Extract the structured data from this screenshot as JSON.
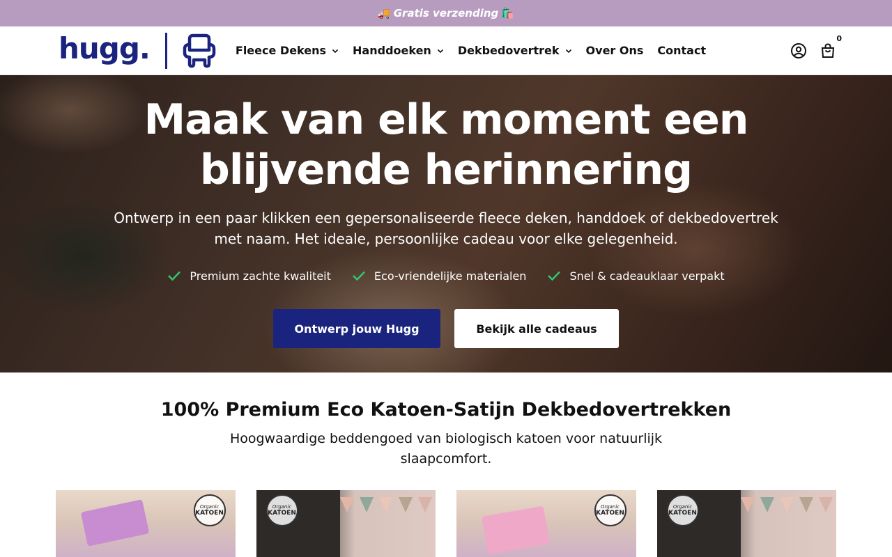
{
  "announcement": {
    "icon_left": "🚚",
    "text": "Gratis verzending",
    "icon_right": "🛍️"
  },
  "header": {
    "logo_text": "hugg.",
    "nav": [
      {
        "label": "Fleece Dekens",
        "has_dropdown": true
      },
      {
        "label": "Handdoeken",
        "has_dropdown": true
      },
      {
        "label": "Dekbedovertrek",
        "has_dropdown": true
      },
      {
        "label": "Over Ons",
        "has_dropdown": false
      },
      {
        "label": "Contact",
        "has_dropdown": false
      }
    ],
    "cart_count": "0"
  },
  "hero": {
    "title": "Maak van elk moment een blijvende herinnering",
    "subtitle": "Ontwerp in een paar klikken een gepersonaliseerde fleece deken, handdoek of dekbedovertrek met naam. Het ideale, persoonlijke cadeau voor elke gelegenheid.",
    "usps": [
      "Premium zachte kwaliteit",
      "Eco-vriendelijke materialen",
      "Snel & cadeauklaar verpakt"
    ],
    "primary_button": "Ontwerp jouw Hugg",
    "secondary_button": "Bekijk alle cadeaus"
  },
  "collection": {
    "title": "100% Premium Eco Katoen-Satijn Dekbedovertrekken",
    "subtitle": "Hoogwaardige beddengoed van biologisch katoen voor natuurlijk slaapcomfort.",
    "badge_line1": "Organic",
    "badge_line2": "KATOEN"
  },
  "colors": {
    "announcement_bg": "#b89cc0",
    "brand_navy": "#1a237e",
    "check_green": "#2ecc71"
  }
}
